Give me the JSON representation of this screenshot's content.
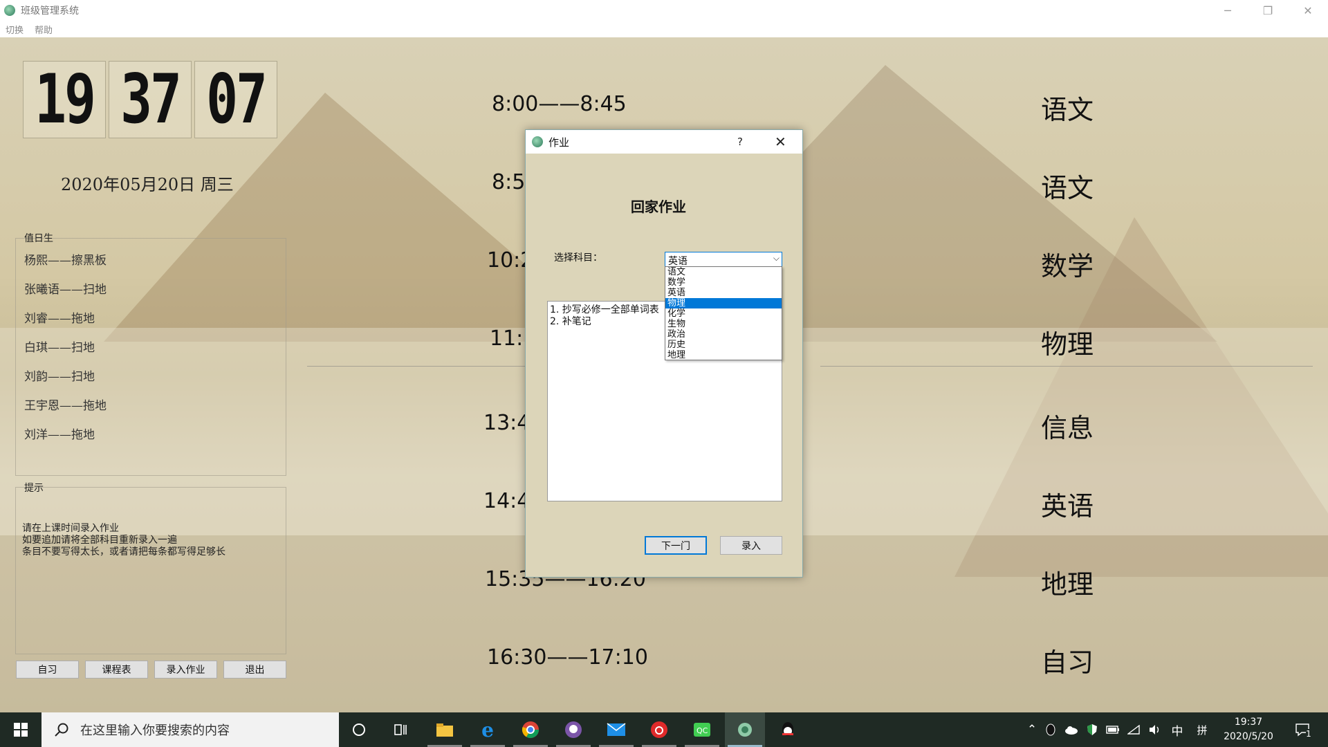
{
  "window": {
    "title": "班级管理系统",
    "controls": [
      "─",
      "❐",
      "✕"
    ]
  },
  "menu": [
    "切换",
    "帮助"
  ],
  "clock": {
    "hh": "19",
    "mm": "37",
    "ss": "07"
  },
  "date": "2020年05月20日  周三",
  "duty": {
    "title": "值日生",
    "items": [
      "杨熙——擦黑板",
      "张曦语——扫地",
      "刘睿——拖地",
      "白琪——扫地",
      "刘韵——扫地",
      "王宇恩——拖地",
      "刘洋——拖地"
    ]
  },
  "tips": {
    "title": "提示",
    "lines": [
      "请在上课时间录入作业",
      "如要追加请将全部科目重新录入一遍",
      "条目不要写得太长，或者请把每条都写得足够长"
    ]
  },
  "buttons": [
    "自习",
    "课程表",
    "录入作业",
    "退出"
  ],
  "schedule": [
    {
      "time": "8:00——8:45",
      "subject": "语文"
    },
    {
      "time": "8:55",
      "subject": "语文"
    },
    {
      "time": "10:2",
      "subject": "数学"
    },
    {
      "time": "11:15",
      "subject": "物理"
    },
    {
      "time": "13:40",
      "subject": "信息"
    },
    {
      "time": "14:40",
      "subject": "英语"
    },
    {
      "time": "15:35——16:20",
      "subject": "地理"
    },
    {
      "time": "16:30——17:10",
      "subject": "自习"
    }
  ],
  "dialog": {
    "title": "作业",
    "help": "?",
    "close": "✕",
    "heading": "回家作业",
    "label": "选择科目：",
    "selected": "英语",
    "options": [
      "语文",
      "数学",
      "英语",
      "物理",
      "化学",
      "生物",
      "政治",
      "历史",
      "地理"
    ],
    "highlighted": "物理",
    "homework": [
      "1. 抄写必修一全部单词表",
      "2. 补笔记"
    ],
    "next_button": "下一门",
    "submit_button": "录入"
  },
  "taskbar": {
    "search_placeholder": "在这里输入你要搜索的内容",
    "ime": "中",
    "ime2": "拼",
    "time": "19:37",
    "date": "2020/5/20",
    "notif_count": "1"
  },
  "colors": {
    "taskbar": "#1f2a24",
    "accent": "#0078d7"
  }
}
